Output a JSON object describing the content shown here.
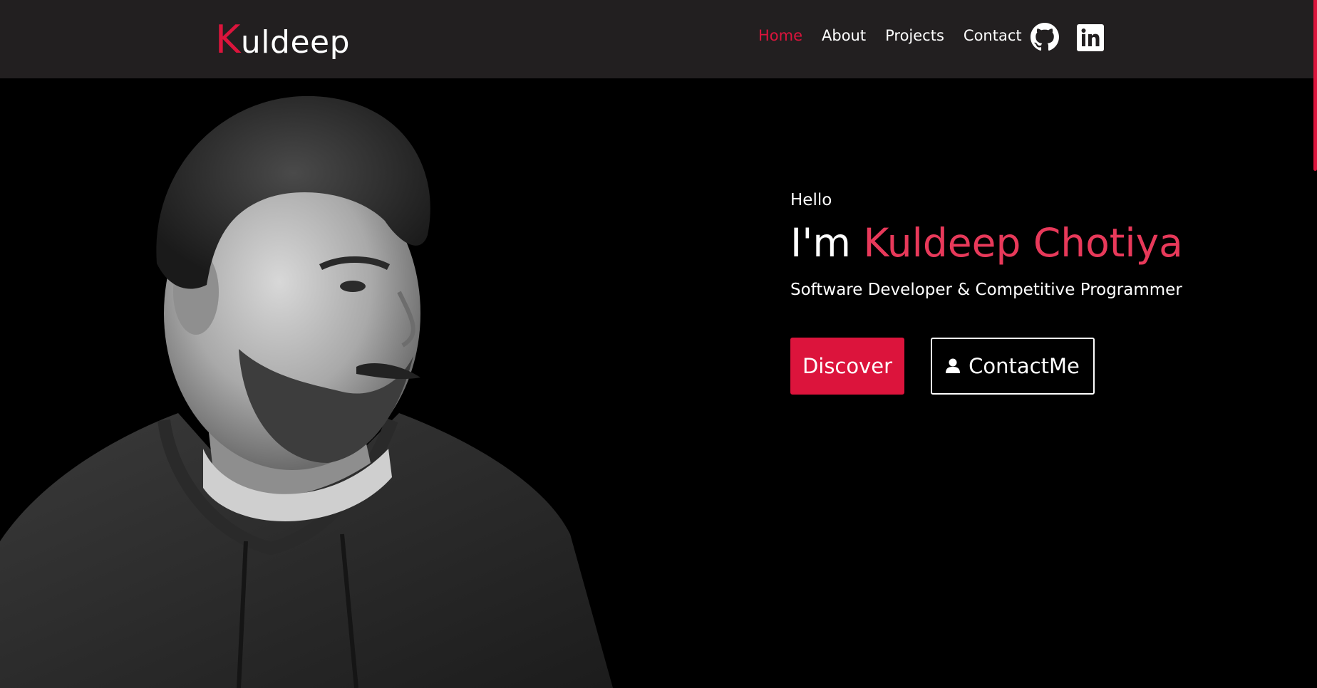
{
  "colors": {
    "accent": "#dc143c",
    "name_accent": "#e8395a",
    "navbar_bg": "#221f20",
    "page_bg": "#000000",
    "text": "#ffffff"
  },
  "navbar": {
    "logo_initial": "K",
    "logo_rest": "uldeep",
    "links": [
      {
        "label": "Home",
        "active": true
      },
      {
        "label": "About",
        "active": false
      },
      {
        "label": "Projects",
        "active": false
      },
      {
        "label": "Contact",
        "active": false
      }
    ],
    "social": [
      {
        "icon": "github-icon"
      },
      {
        "icon": "linkedin-icon"
      }
    ]
  },
  "hero": {
    "greeting": "Hello",
    "intro": "I'm",
    "name": "Kuldeep Chotiya",
    "subtitle": "Software Developer & Competitive Programmer",
    "discover_label": "Discover",
    "contact_label": "ContactMe",
    "contact_icon": "user-icon",
    "portrait": "grayscale photo of a bearded man in a dark hoodie looking right"
  }
}
